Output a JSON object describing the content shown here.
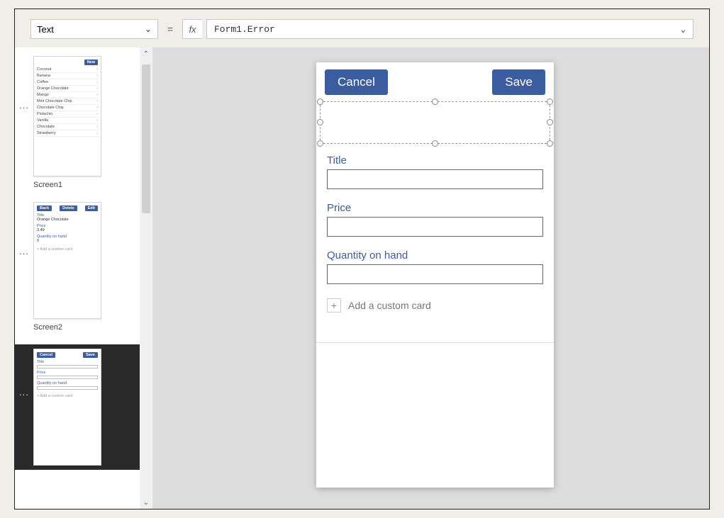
{
  "formula_bar": {
    "property": "Text",
    "equals": "=",
    "fx": "fx",
    "expression": "Form1.Error"
  },
  "thumbnails": {
    "screen1": {
      "caption": "Screen1",
      "new_button": "New",
      "items": [
        "Coconut",
        "Banana",
        "Coffee",
        "Orange Chocolate",
        "Mango",
        "Mint Chocolate Chip",
        "Chocolate Chip",
        "Pistachio",
        "Vanilla",
        "Chocolate",
        "Strawberry"
      ]
    },
    "screen2": {
      "caption": "Screen2",
      "back": "Back",
      "delete": "Delete",
      "edit": "Edit",
      "title_label": "Title",
      "title_val": "Orange Chocolate",
      "price_label": "Price",
      "price_val": "3.49",
      "qty_label": "Quantity on hand",
      "qty_val": "0",
      "add_card": "+  Add a custom card"
    },
    "screen3": {
      "cancel": "Cancel",
      "save": "Save",
      "title_label": "Title",
      "price_label": "Price",
      "qty_label": "Quantity on hand",
      "add_card": "+  Add a custom card"
    }
  },
  "form": {
    "cancel": "Cancel",
    "save": "Save",
    "fields": {
      "title": "Title",
      "price": "Price",
      "qty": "Quantity on hand"
    },
    "add_card": "Add a custom card"
  }
}
